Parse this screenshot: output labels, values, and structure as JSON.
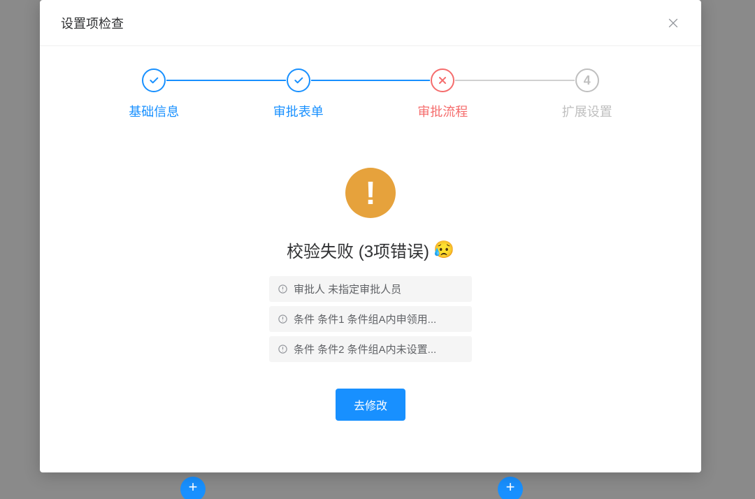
{
  "modal": {
    "title": "设置项检查"
  },
  "steps": [
    {
      "label": "基础信息",
      "state": "done",
      "icon": "check"
    },
    {
      "label": "审批表单",
      "state": "done",
      "icon": "check"
    },
    {
      "label": "审批流程",
      "state": "error",
      "icon": "cross"
    },
    {
      "label": "扩展设置",
      "state": "wait",
      "icon": "4"
    }
  ],
  "result": {
    "title": "校验失败 (3项错误)",
    "emoji": "😥"
  },
  "errors": [
    "审批人 未指定审批人员",
    "条件 条件1 条件组A内申领用...",
    "条件 条件2 条件组A内未设置..."
  ],
  "action": {
    "label": "去修改"
  }
}
